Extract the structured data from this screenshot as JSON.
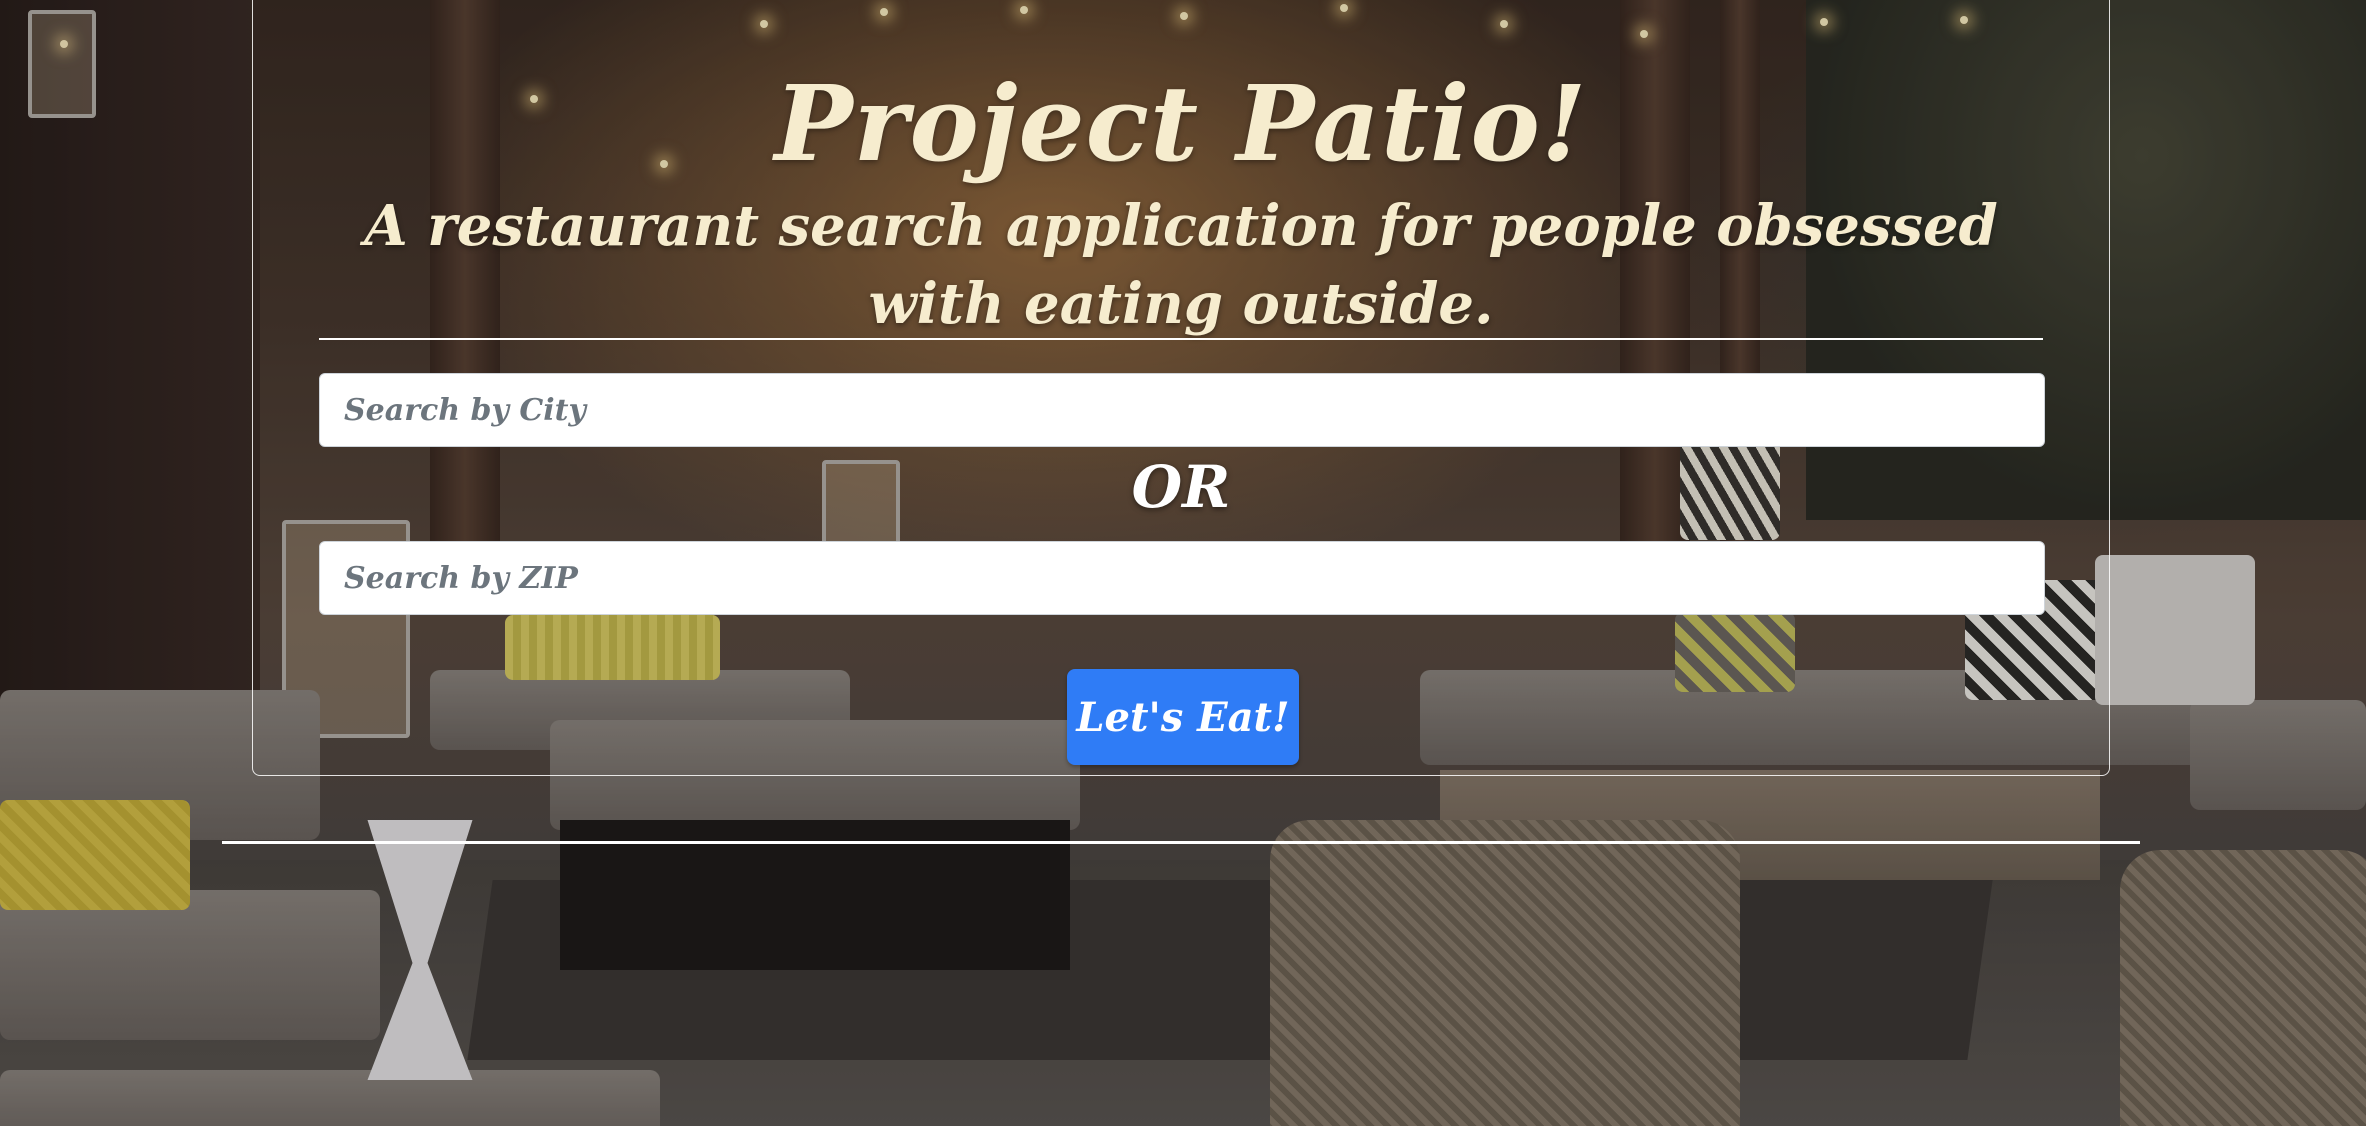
{
  "page": {
    "title": "Project Patio!",
    "subtitle": "A restaurant search application for people obsessed with eating outside."
  },
  "search": {
    "city_placeholder": "Search by City",
    "city_value": "",
    "or_label": "OR",
    "zip_placeholder": "Search by ZIP",
    "zip_value": "",
    "submit_label": "Let's Eat!"
  },
  "colors": {
    "title_text": "#f6ecce",
    "button_bg": "#2f7cf6",
    "divider": "#ffffff"
  },
  "background": {
    "icon": "patio-photo-background"
  }
}
